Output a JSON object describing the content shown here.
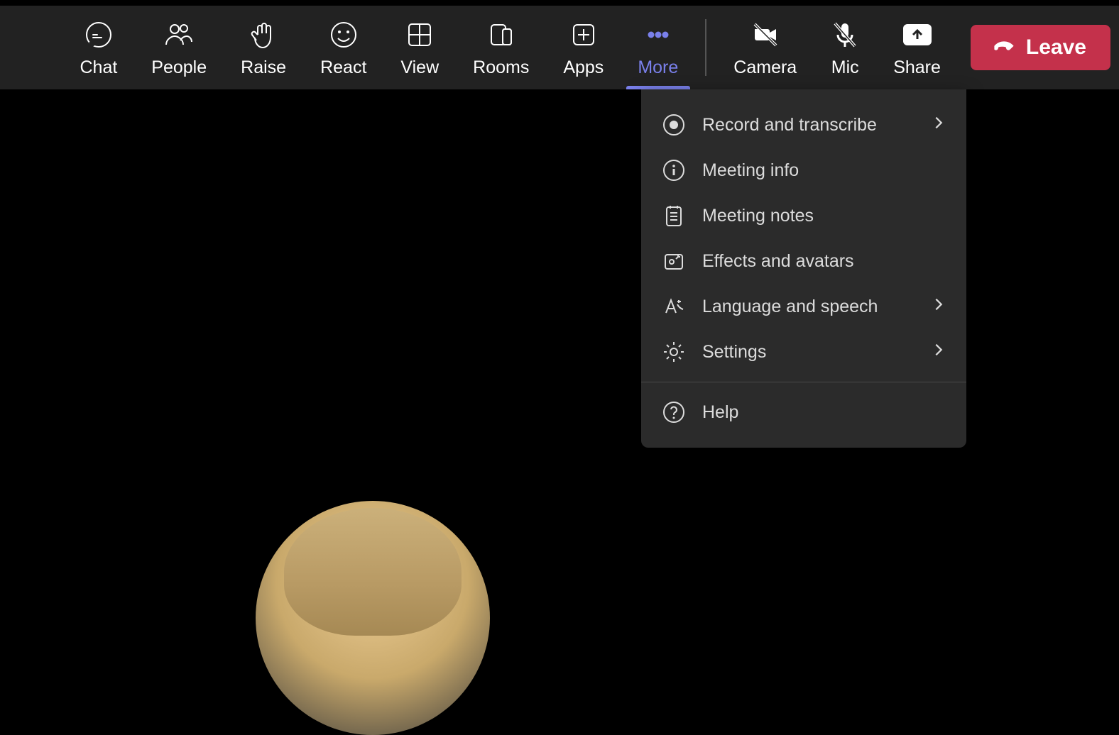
{
  "toolbar": {
    "chat": "Chat",
    "people": "People",
    "raise": "Raise",
    "react": "React",
    "view": "View",
    "rooms": "Rooms",
    "apps": "Apps",
    "more": "More",
    "camera": "Camera",
    "mic": "Mic",
    "share": "Share",
    "leave": "Leave"
  },
  "more_menu": {
    "record": "Record and transcribe",
    "info": "Meeting info",
    "notes": "Meeting notes",
    "effects": "Effects and avatars",
    "language": "Language and speech",
    "settings": "Settings",
    "help": "Help"
  },
  "state": {
    "camera_muted": true,
    "mic_muted": true,
    "more_open": true
  },
  "colors": {
    "accent": "#7a80eb",
    "leave": "#c4314b",
    "bg_bar": "#222222",
    "bg_menu": "#2b2b2b"
  }
}
